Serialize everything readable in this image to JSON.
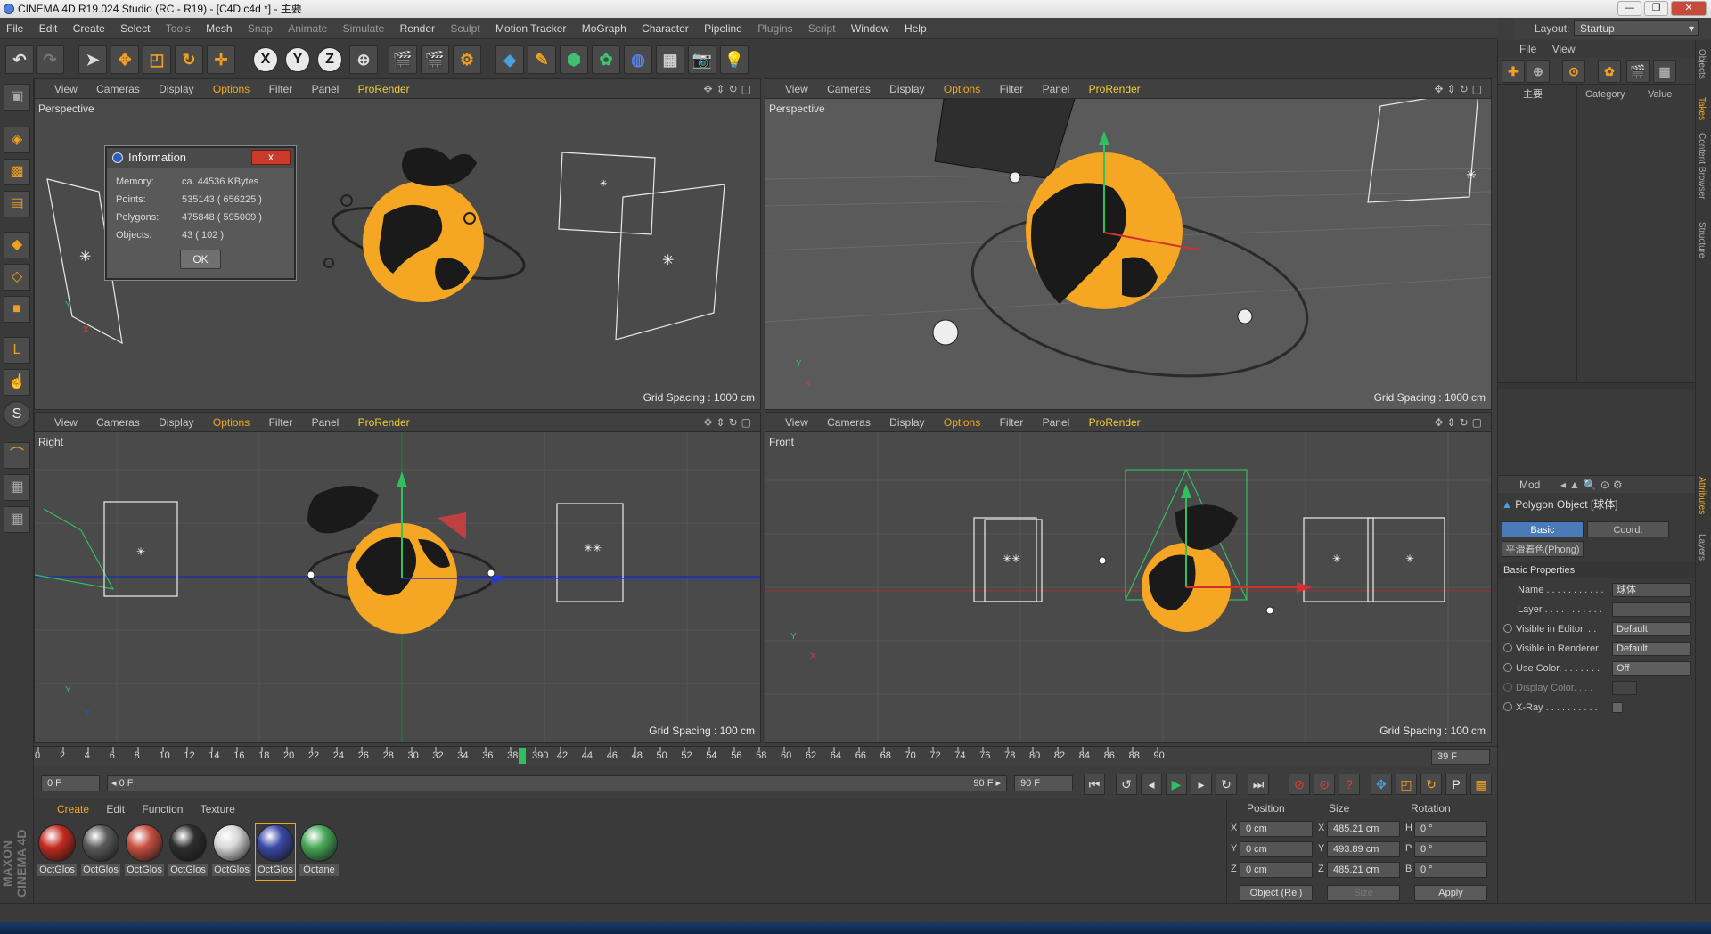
{
  "window": {
    "title": "CINEMA 4D R19.024 Studio (RC - R19) - [C4D.c4d *] - 主要"
  },
  "menu": [
    "File",
    "Edit",
    "Create",
    "Select",
    "Tools",
    "Mesh",
    "Snap",
    "Animate",
    "Simulate",
    "Render",
    "Sculpt",
    "Motion Tracker",
    "MoGraph",
    "Character",
    "Pipeline",
    "Plugins",
    "Script",
    "Window",
    "Help"
  ],
  "layout": {
    "label": "Layout:",
    "value": "Startup"
  },
  "viewport_menu": {
    "view": "View",
    "cameras": "Cameras",
    "display": "Display",
    "options": "Options",
    "filter": "Filter",
    "panel": "Panel",
    "prorender": "ProRender"
  },
  "viewports": [
    {
      "name": "Perspective",
      "grid": "Grid Spacing : 1000 cm"
    },
    {
      "name": "Perspective",
      "grid": "Grid Spacing : 1000 cm"
    },
    {
      "name": "Right",
      "grid": "Grid Spacing : 100 cm"
    },
    {
      "name": "Front",
      "grid": "Grid Spacing : 100 cm"
    }
  ],
  "info_dialog": {
    "title": "Information",
    "close": "x",
    "rows": [
      {
        "label": "Memory:",
        "value": "ca. 44536 KBytes"
      },
      {
        "label": "Points:",
        "value": "535143 ( 656225 )"
      },
      {
        "label": "Polygons:",
        "value": "475848 ( 595009 )"
      },
      {
        "label": "Objects:",
        "value": "43 ( 102 )"
      }
    ],
    "ok": "OK"
  },
  "timeline": {
    "ticks": [
      "0",
      "2",
      "4",
      "6",
      "8",
      "10",
      "12",
      "14",
      "16",
      "18",
      "20",
      "22",
      "24",
      "26",
      "28",
      "30",
      "32",
      "34",
      "36",
      "38",
      "390",
      "42",
      "44",
      "46",
      "48",
      "50",
      "52",
      "54",
      "56",
      "58",
      "60",
      "62",
      "64",
      "66",
      "68",
      "70",
      "72",
      "74",
      "76",
      "78",
      "80",
      "82",
      "84",
      "86",
      "88",
      "90"
    ],
    "current_frame": 39,
    "end_label": "39 F"
  },
  "transport": {
    "start": "0 F",
    "slider_start": "0 F",
    "slider_end": "90 F",
    "end": "90 F"
  },
  "materials": {
    "tabs": [
      "Create",
      "Edit",
      "Function",
      "Texture"
    ],
    "items": [
      {
        "label": "OctGlos",
        "color": "#c42a20"
      },
      {
        "label": "OctGlos",
        "color": "#5a5a5a"
      },
      {
        "label": "OctGlos",
        "color": "#c85040"
      },
      {
        "label": "OctGlos",
        "color": "#2e2e2e"
      },
      {
        "label": "OctGlos",
        "color": "#d8d8d8"
      },
      {
        "label": "OctGlos",
        "color": "#3a4aa8"
      },
      {
        "label": "Octane",
        "color": "#48a858"
      }
    ]
  },
  "coords": {
    "headers": {
      "position": "Position",
      "size": "Size",
      "rotation": "Rotation"
    },
    "rows": [
      {
        "axis": "X",
        "pos": "0 cm",
        "size_axis": "X",
        "size": "485.21 cm",
        "rot_axis": "H",
        "rot": "0 °"
      },
      {
        "axis": "Y",
        "pos": "0 cm",
        "size_axis": "Y",
        "size": "493.89 cm",
        "rot_axis": "P",
        "rot": "0 °"
      },
      {
        "axis": "Z",
        "pos": "0 cm",
        "size_axis": "Z",
        "size": "485.21 cm",
        "rot_axis": "B",
        "rot": "0 °"
      }
    ],
    "mode": "Object (Rel)",
    "size_mode": "Size",
    "apply": "Apply"
  },
  "objects_panel": {
    "file": "File",
    "view": "View",
    "tab_main": "主要",
    "category": "Category",
    "value": "Value"
  },
  "attributes": {
    "mode": "Mod",
    "object": "Polygon Object [球体]",
    "tabs": {
      "basic": "Basic",
      "coord": "Coord.",
      "phong": "平滑着色(Phong)"
    },
    "section": "Basic Properties",
    "rows": [
      {
        "label": "Name . . . . . . . . . . .",
        "value": "球体"
      },
      {
        "label": "Layer . . . . . . . . . . .",
        "value": ""
      },
      {
        "label": "Visible in Editor. . .",
        "value": "Default"
      },
      {
        "label": "Visible in Renderer",
        "value": "Default"
      },
      {
        "label": "Use Color. . . . . . . .",
        "value": "Off"
      },
      {
        "label": "Display Color. . . .",
        "value": ""
      },
      {
        "label": "X-Ray . . . . . . . . . .",
        "value": ""
      }
    ]
  },
  "side_tabs": [
    "Objects",
    "Takes",
    "Content Browser",
    "Structure",
    "Attributes",
    "Layers"
  ],
  "brand": "MAXON CINEMA 4D",
  "colors": {
    "accent": "#f0a820",
    "globe": "#f5a623",
    "selection": "#30c060"
  }
}
